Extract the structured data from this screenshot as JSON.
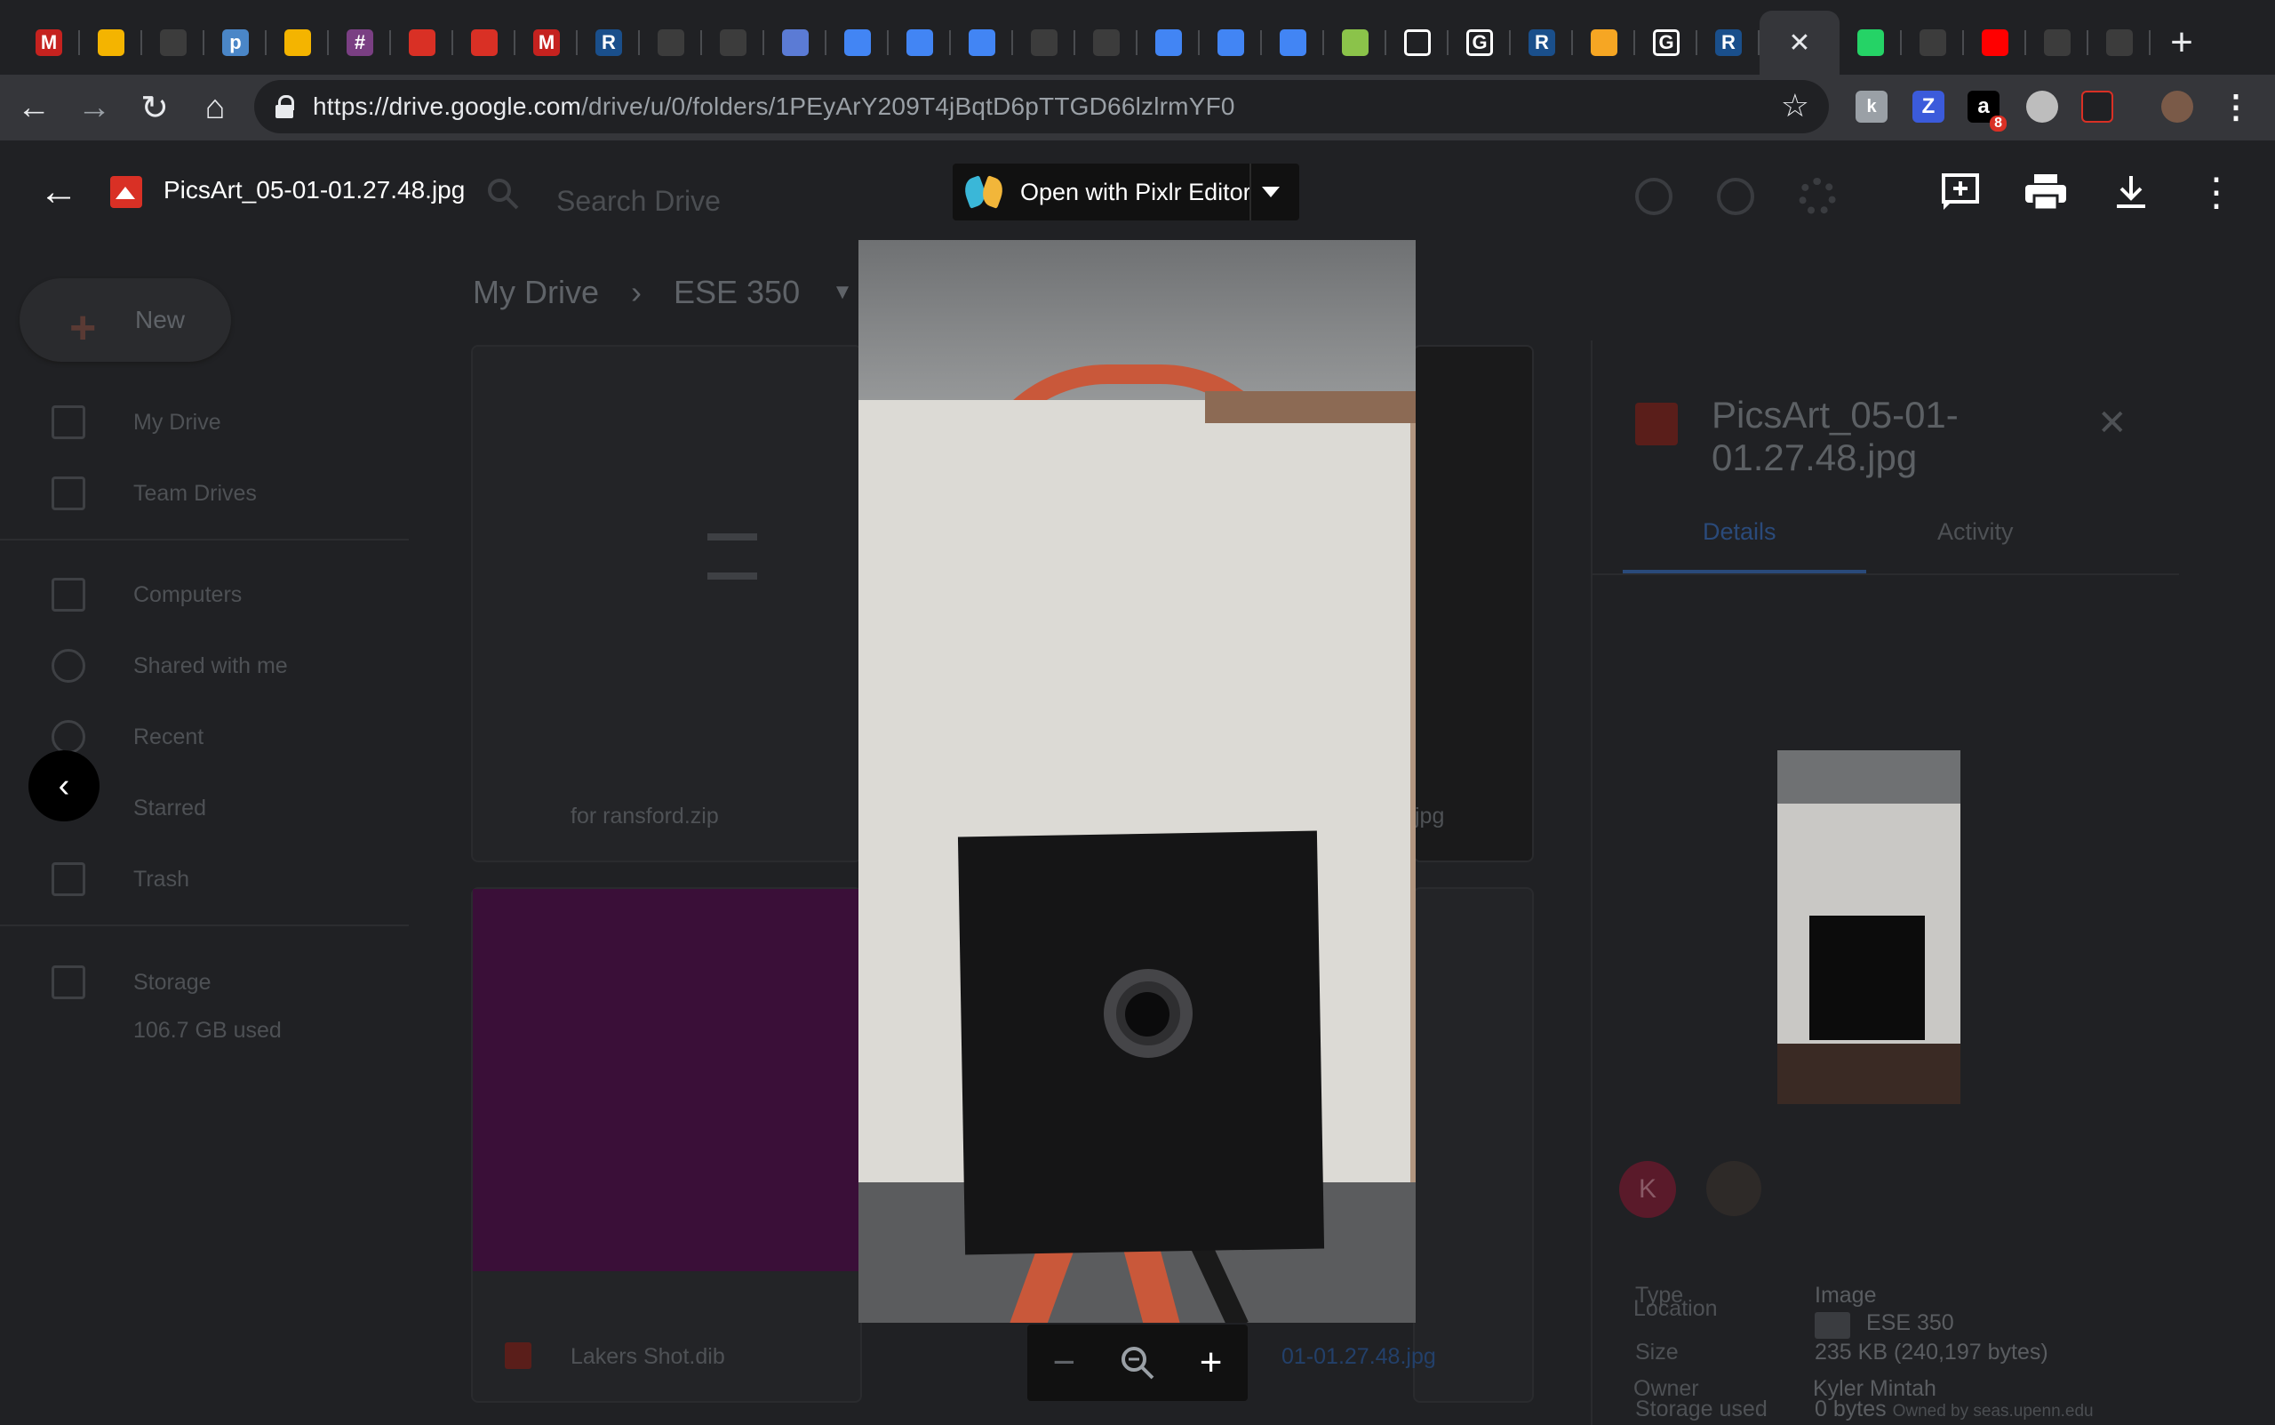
{
  "browser": {
    "tabs": [
      {
        "icon": "gmail-icon",
        "letter": "M",
        "color": "#c5221f"
      },
      {
        "icon": "slides-icon",
        "letter": "",
        "color": "#f4b400"
      },
      {
        "icon": "github-icon",
        "letter": "",
        "color": "#3c3c3c"
      },
      {
        "icon": "piazza-icon",
        "letter": "p",
        "color": "#4a86c7"
      },
      {
        "icon": "slides-icon",
        "letter": "",
        "color": "#f4b400"
      },
      {
        "icon": "slack-icon",
        "letter": "#",
        "color": "#7a3f83"
      },
      {
        "icon": "espruino-icon",
        "letter": "",
        "color": "#d93025"
      },
      {
        "icon": "espruino-icon",
        "letter": "",
        "color": "#d93025"
      },
      {
        "icon": "gmail-icon",
        "letter": "M",
        "color": "#c5221f"
      },
      {
        "icon": "r-icon",
        "letter": "R",
        "color": "#1a4f8b"
      },
      {
        "icon": "github-icon",
        "letter": "",
        "color": "#3c3c3c"
      },
      {
        "icon": "github-icon",
        "letter": "",
        "color": "#3c3c3c"
      },
      {
        "icon": "dashboard-icon",
        "letter": "",
        "color": "#5b7bd5"
      },
      {
        "icon": "gcloud-icon",
        "letter": "",
        "color": "#4285f4"
      },
      {
        "icon": "gcloud-icon",
        "letter": "",
        "color": "#4285f4"
      },
      {
        "icon": "gcloud-icon",
        "letter": "",
        "color": "#4285f4"
      },
      {
        "icon": "github-icon",
        "letter": "",
        "color": "#3c3c3c"
      },
      {
        "icon": "github-icon",
        "letter": "",
        "color": "#3c3c3c"
      },
      {
        "icon": "gcloud-icon",
        "letter": "",
        "color": "#4285f4"
      },
      {
        "icon": "gcloud-icon",
        "letter": "",
        "color": "#4285f4"
      },
      {
        "icon": "gcloud-icon",
        "letter": "",
        "color": "#4285f4"
      },
      {
        "icon": "android-icon",
        "letter": "",
        "color": "#8bc34a"
      },
      {
        "icon": "doc-icon",
        "letter": "",
        "color": "#ffffff"
      },
      {
        "icon": "google-icon",
        "letter": "G",
        "color": "#ffffff"
      },
      {
        "icon": "r-icon",
        "letter": "R",
        "color": "#1a4f8b"
      },
      {
        "icon": "firebase-icon",
        "letter": "",
        "color": "#f6a623"
      },
      {
        "icon": "google-icon",
        "letter": "G",
        "color": "#ffffff"
      },
      {
        "icon": "r-icon",
        "letter": "R",
        "color": "#1a4f8b"
      }
    ],
    "tabs_after": [
      {
        "icon": "whatsapp-icon",
        "letter": "",
        "color": "#25d366"
      },
      {
        "icon": "github-icon",
        "letter": "",
        "color": "#3c3c3c"
      },
      {
        "icon": "youtube-icon",
        "letter": "",
        "color": "#ff0000"
      },
      {
        "icon": "github-icon",
        "letter": "",
        "color": "#3c3c3c"
      },
      {
        "icon": "github-icon",
        "letter": "",
        "color": "#3c3c3c"
      }
    ],
    "url_host": "https://drive.google.com",
    "url_path": "/drive/u/0/folders/1PEyArY209T4jBqtD6pTTGD66lzlrmYF0",
    "extension_badge": "8"
  },
  "drive": {
    "search_placeholder": "Search Drive",
    "new_label": "New",
    "sidebar": [
      {
        "label": "My Drive"
      },
      {
        "label": "Team Drives"
      },
      {
        "label": "Computers"
      },
      {
        "label": "Shared with me"
      },
      {
        "label": "Recent"
      },
      {
        "label": "Starred"
      },
      {
        "label": "Trash"
      },
      {
        "label": "Storage"
      }
    ],
    "storage_used": "106.7 GB used",
    "breadcrumb": {
      "root": "My Drive",
      "current": "ESE 350"
    },
    "files": {
      "zip": "for ransford.zip",
      "jpg_suffix": "jpg",
      "dib": "Lakers Shot.dib",
      "jpg2": "01-01.27.48.jpg"
    },
    "details": {
      "title": "PicsArt_05-01-01.27.48.jpg",
      "tab_details": "Details",
      "tab_activity": "Activity",
      "avatar_letter": "K",
      "rows": [
        {
          "label": "Type",
          "value": "Image"
        },
        {
          "label": "Size",
          "value": "235 KB (240,197 bytes)"
        },
        {
          "label": "Storage used",
          "value": "0 bytes",
          "note": "Owned by seas.upenn.edu"
        },
        {
          "label": "Location",
          "value": "ESE 350"
        },
        {
          "label": "Owner",
          "value": "Kyler Mintah"
        }
      ]
    }
  },
  "viewer": {
    "file_name": "PicsArt_05-01-01.27.48.jpg",
    "open_with_label": "Open with Pixlr Editor"
  }
}
